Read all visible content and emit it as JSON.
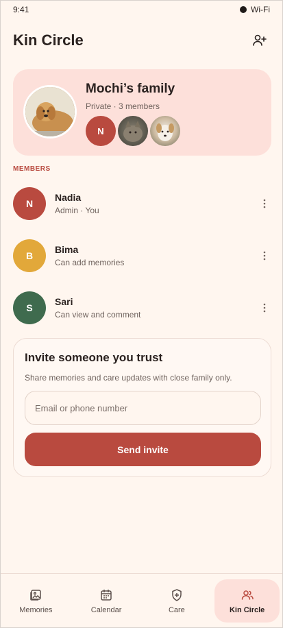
{
  "status_bar": {
    "time": "9:41",
    "wifi": "Wi-Fi"
  },
  "header": {
    "title": "Kin Circle",
    "action_icon": "add-person-icon"
  },
  "family": {
    "name": "Mochi’s family",
    "meta": "Private · 3 members",
    "avatars": [
      {
        "initial": "N",
        "color": "#b94a3f"
      },
      {
        "type": "photo",
        "desc": "cat"
      },
      {
        "type": "photo",
        "desc": "dog"
      }
    ]
  },
  "members_label": "MEMBERS",
  "members": [
    {
      "initial": "N",
      "name": "Nadia",
      "role": "Admin · You",
      "color": "#b94a3f"
    },
    {
      "initial": "B",
      "name": "Bima",
      "role": "Can add memories",
      "color": "#e2a83a"
    },
    {
      "initial": "S",
      "name": "Sari",
      "role": "Can view and comment",
      "color": "#3f6b4e"
    }
  ],
  "invite": {
    "title": "Invite someone you trust",
    "subtitle": "Share memories and care updates with close family only.",
    "input_placeholder": "Email or phone number",
    "button_label": "Send invite"
  },
  "nav": [
    {
      "label": "Memories",
      "icon": "gallery-icon",
      "active": false
    },
    {
      "label": "Calendar",
      "icon": "calendar-icon",
      "active": false
    },
    {
      "label": "Care",
      "icon": "shield-plus-icon",
      "active": false
    },
    {
      "label": "Kin Circle",
      "icon": "people-icon",
      "active": true
    }
  ],
  "colors": {
    "accent": "#b94a3f",
    "card_bg": "#fde0da",
    "background": "#fff6ef"
  }
}
